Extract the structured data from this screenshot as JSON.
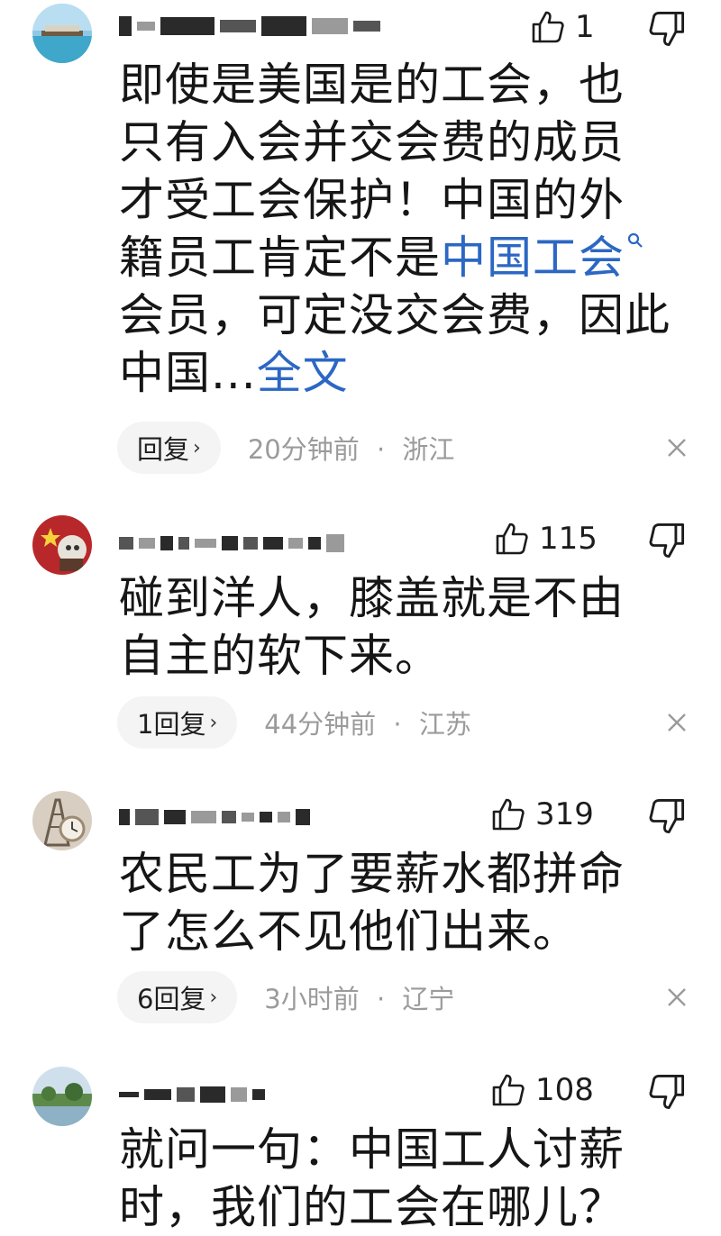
{
  "comments": [
    {
      "text_before_link": "即使是美国是的工会，也\n只有入会并交会费的成员\n才受工会保护！中国的外\n籍员工肯定不是",
      "link_text": "中国工会",
      "text_after_link": "\n会员，可定没交会费，因此\n中国...",
      "expand_label": "全文",
      "likes": "1",
      "reply_label": "回复",
      "time": "20分钟前",
      "separator": "·",
      "location": "浙江"
    },
    {
      "text": "碰到洋人，膝盖就是不由\n自主的软下来。",
      "likes": "115",
      "reply_label": "1回复",
      "time": "44分钟前",
      "separator": "·",
      "location": "江苏"
    },
    {
      "text": "农民工为了要薪水都拼命\n了怎么不见他们出来。",
      "likes": "319",
      "reply_label": "6回复",
      "time": "3小时前",
      "separator": "·",
      "location": "辽宁"
    },
    {
      "text": "就问一句：中国工人讨薪\n时，我们的工会在哪儿？",
      "likes": "108"
    }
  ],
  "icons": {
    "like": "thumb-up-icon",
    "dislike": "thumb-down-icon",
    "close": "close-icon",
    "chevron": "chevron-right-icon",
    "search": "search-icon"
  },
  "colors": {
    "link": "#2c67c3",
    "meta_text": "#9b9b9b",
    "pill_bg": "#f4f4f4"
  }
}
